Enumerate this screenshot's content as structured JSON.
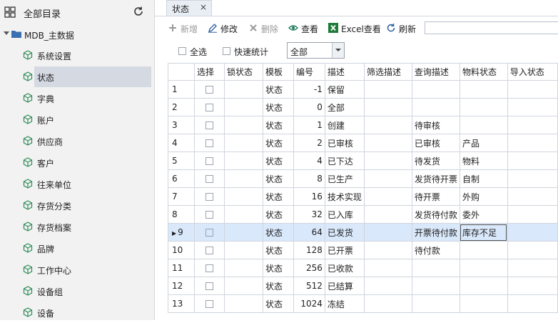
{
  "sidebar": {
    "title": "全部目录",
    "root": "MDB_主数据",
    "items": [
      "系统设置",
      "状态",
      "字典",
      "账户",
      "供应商",
      "客户",
      "往来单位",
      "存货分类",
      "存货档案",
      "品牌",
      "工作中心",
      "设备组",
      "设备"
    ],
    "selected_index": 1
  },
  "tabs": [
    {
      "label": "状态",
      "close": "×"
    }
  ],
  "toolbar": {
    "new": "新增",
    "edit": "修改",
    "delete": "删除",
    "view": "查看",
    "excel_view": "Excel查看",
    "refresh": "刷新",
    "search_value": ""
  },
  "filters": {
    "select_all": "全选",
    "quick_stats": "快速统计",
    "dropdown_value": "全部"
  },
  "grid": {
    "columns": [
      "",
      "选择",
      "锁状态",
      "模板",
      "编号",
      "描述",
      "筛选描述",
      "查询描述",
      "物料状态",
      "导入状态"
    ],
    "selected_row": 8,
    "rows": [
      {
        "rn": "1",
        "tpl": "状态",
        "no": "-1",
        "desc": "保留",
        "q": "",
        "m": ""
      },
      {
        "rn": "2",
        "tpl": "状态",
        "no": "0",
        "desc": "全部",
        "q": "",
        "m": ""
      },
      {
        "rn": "3",
        "tpl": "状态",
        "no": "1",
        "desc": "创建",
        "q": "待审核",
        "m": ""
      },
      {
        "rn": "4",
        "tpl": "状态",
        "no": "2",
        "desc": "已审核",
        "q": "已审核",
        "m": "产品"
      },
      {
        "rn": "5",
        "tpl": "状态",
        "no": "4",
        "desc": "已下达",
        "q": "待发货",
        "m": "物料"
      },
      {
        "rn": "6",
        "tpl": "状态",
        "no": "8",
        "desc": "已生产",
        "q": "发货待开票",
        "m": "自制"
      },
      {
        "rn": "7",
        "tpl": "状态",
        "no": "16",
        "desc": "技术实现",
        "q": "待开票",
        "m": "外购"
      },
      {
        "rn": "8",
        "tpl": "状态",
        "no": "32",
        "desc": "已入库",
        "q": "发货待付款",
        "m": "委外"
      },
      {
        "rn": "9",
        "tpl": "状态",
        "no": "64",
        "desc": "已发货",
        "q": "开票待付款",
        "m": "库存不足"
      },
      {
        "rn": "10",
        "tpl": "状态",
        "no": "128",
        "desc": "已开票",
        "q": "待付款",
        "m": ""
      },
      {
        "rn": "11",
        "tpl": "状态",
        "no": "256",
        "desc": "已收款",
        "q": "",
        "m": ""
      },
      {
        "rn": "12",
        "tpl": "状态",
        "no": "512",
        "desc": "已结算",
        "q": "",
        "m": ""
      },
      {
        "rn": "13",
        "tpl": "状态",
        "no": "1024",
        "desc": "冻结",
        "q": "",
        "m": ""
      }
    ]
  },
  "colors": {
    "accent_blue": "#3a7bd5",
    "excel_green": "#1e7b3a",
    "selected_row": "#d9e8fb",
    "sidebar_selected": "#d5d9e2"
  }
}
